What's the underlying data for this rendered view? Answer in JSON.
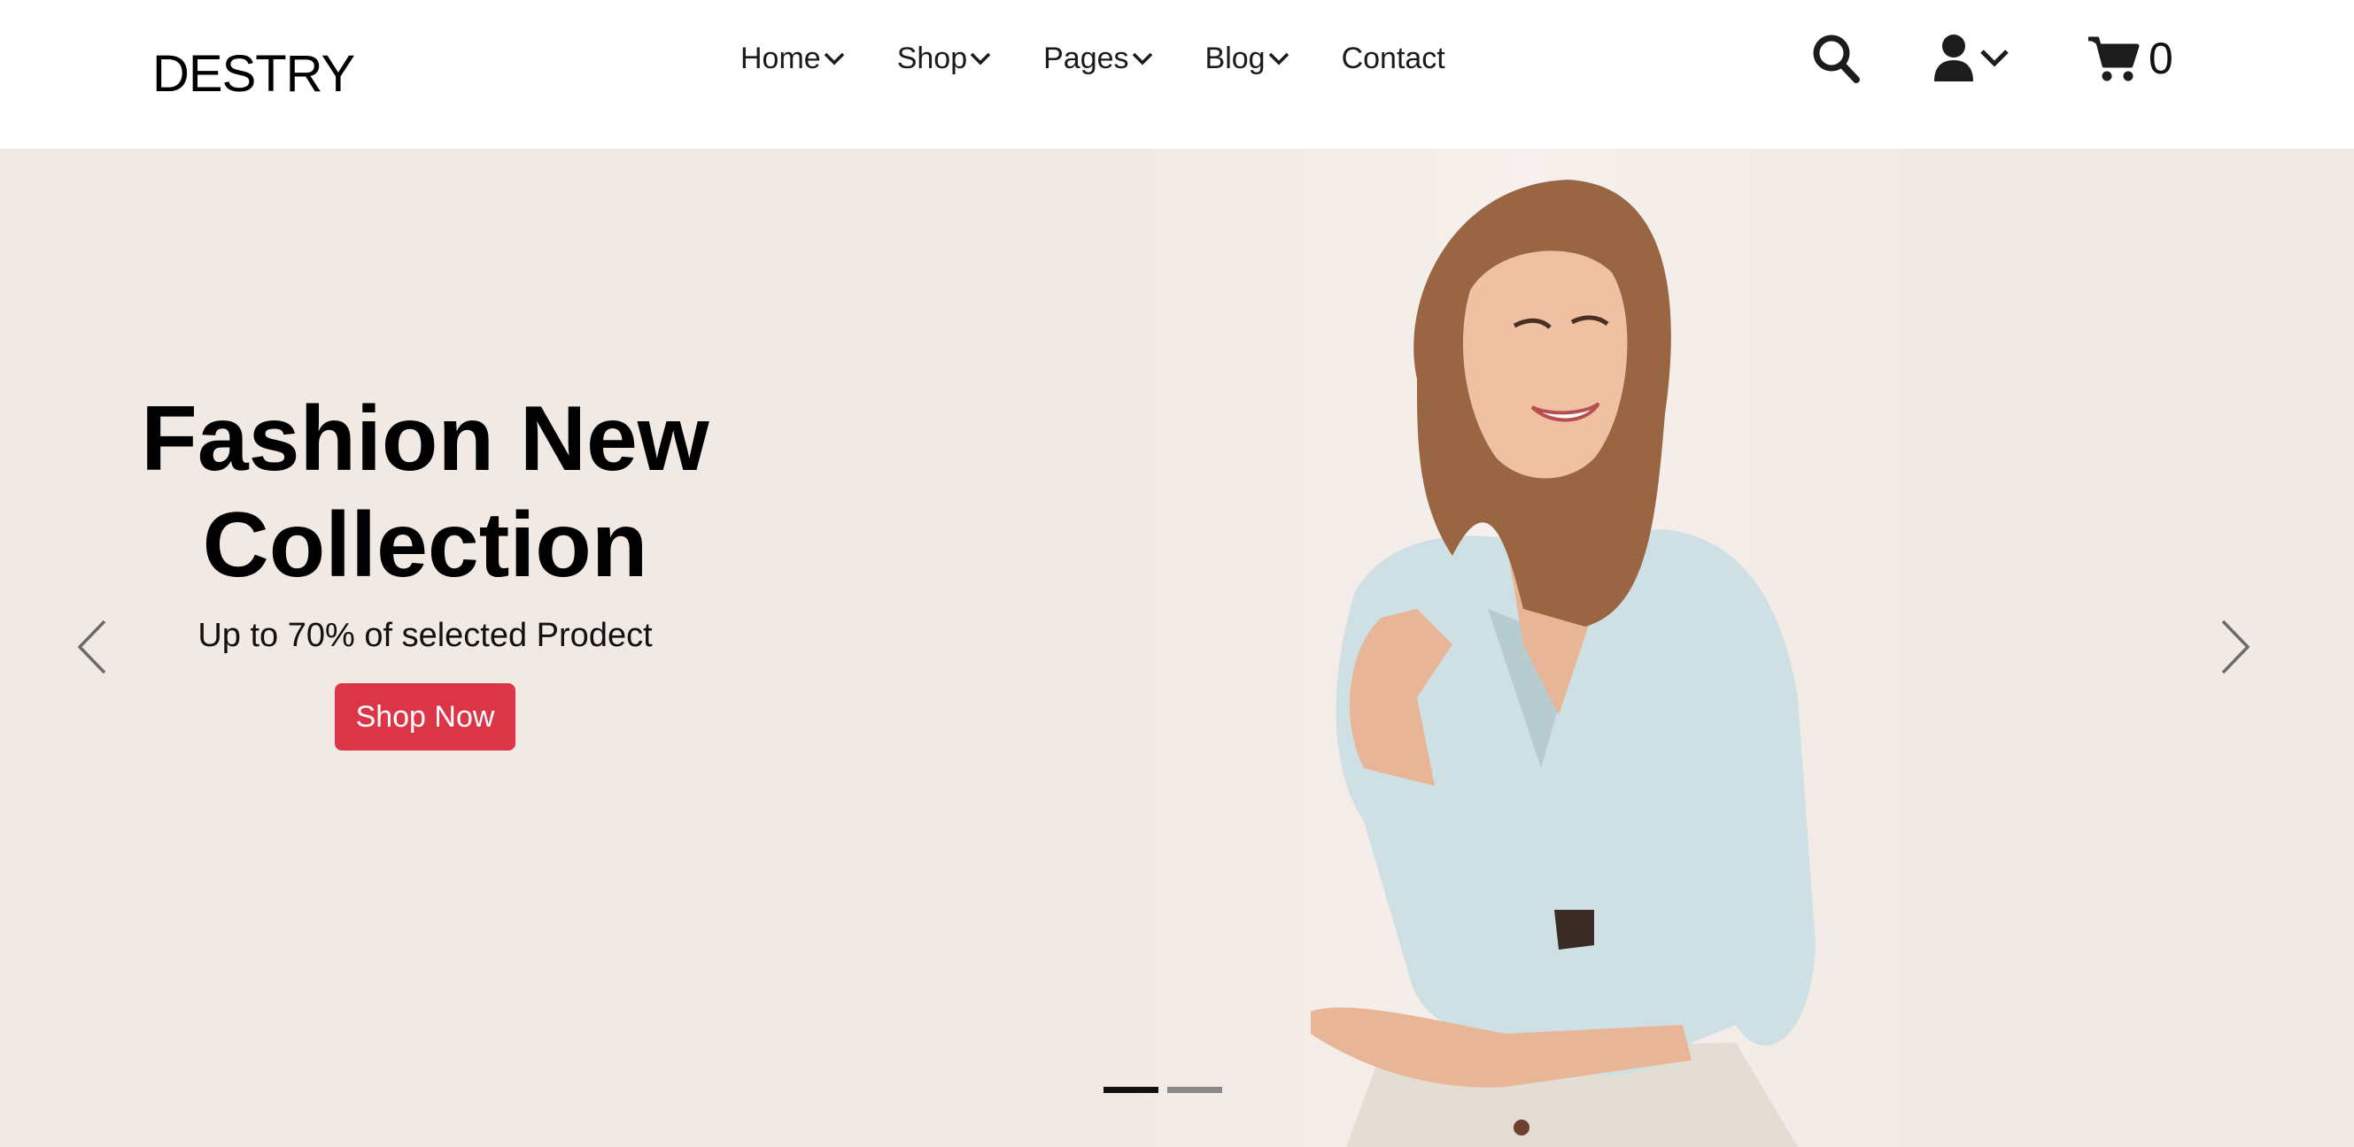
{
  "header": {
    "logo": "DESTRY",
    "nav": [
      {
        "label": "Home",
        "has_dropdown": true
      },
      {
        "label": "Shop",
        "has_dropdown": true
      },
      {
        "label": "Pages",
        "has_dropdown": true
      },
      {
        "label": "Blog",
        "has_dropdown": true
      },
      {
        "label": "Contact",
        "has_dropdown": false
      }
    ],
    "icons": {
      "search": "search-icon",
      "account": "user-icon",
      "cart": "cart-icon"
    },
    "cart_count": "0"
  },
  "hero": {
    "title_line1": "Fashion New",
    "title_line2": "Collection",
    "subtitle": "Up to 70% of selected Prodect",
    "cta_label": "Shop Now",
    "slide_count": 2,
    "active_slide": 1
  },
  "colors": {
    "accent": "#dc3545",
    "hero_bg": "#f1e9e4",
    "dot_active": "#111111",
    "dot_inactive": "#888888"
  }
}
